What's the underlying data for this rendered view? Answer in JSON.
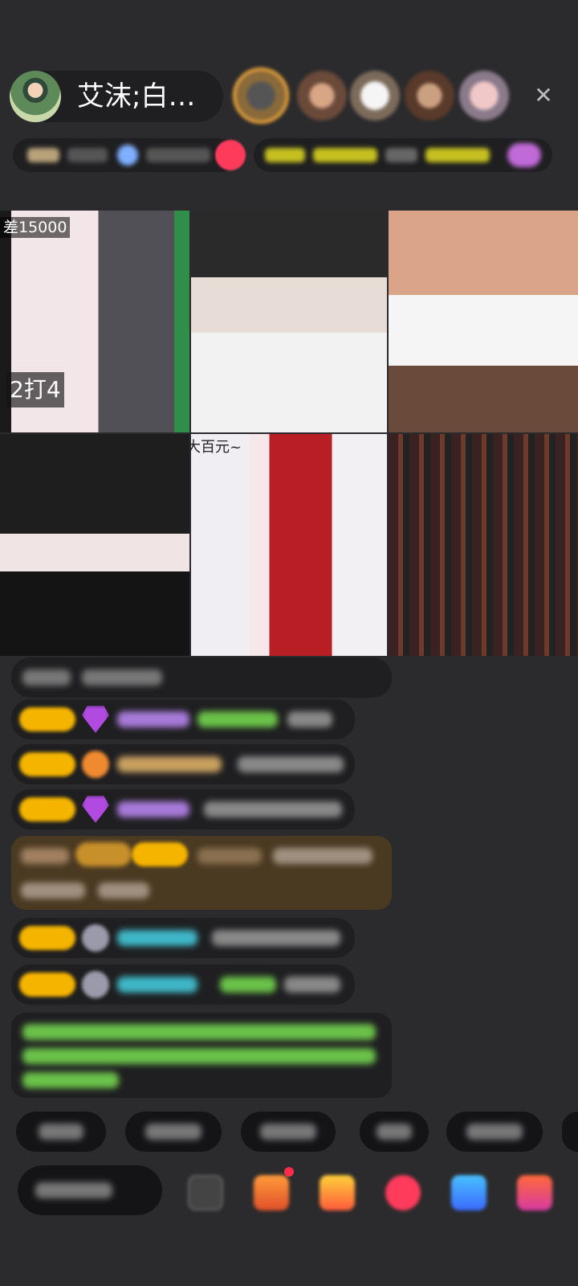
{
  "header": {
    "host_name": "艾沫;白…",
    "close_icon": "close-icon"
  },
  "video_grid": {
    "cells": [
      {
        "score_label": "差15000",
        "round_label": "2打4"
      },
      {},
      {},
      {},
      {
        "caption": "大百元~"
      },
      {}
    ]
  },
  "colors": {
    "background": "#2b2b2d",
    "panel": "#1f1f21",
    "badge_gold": "#f5b400",
    "chat_name_purple": "#a87ad8",
    "chat_name_cyan": "#3fb7c7",
    "chat_system_green": "#6bc24a"
  }
}
